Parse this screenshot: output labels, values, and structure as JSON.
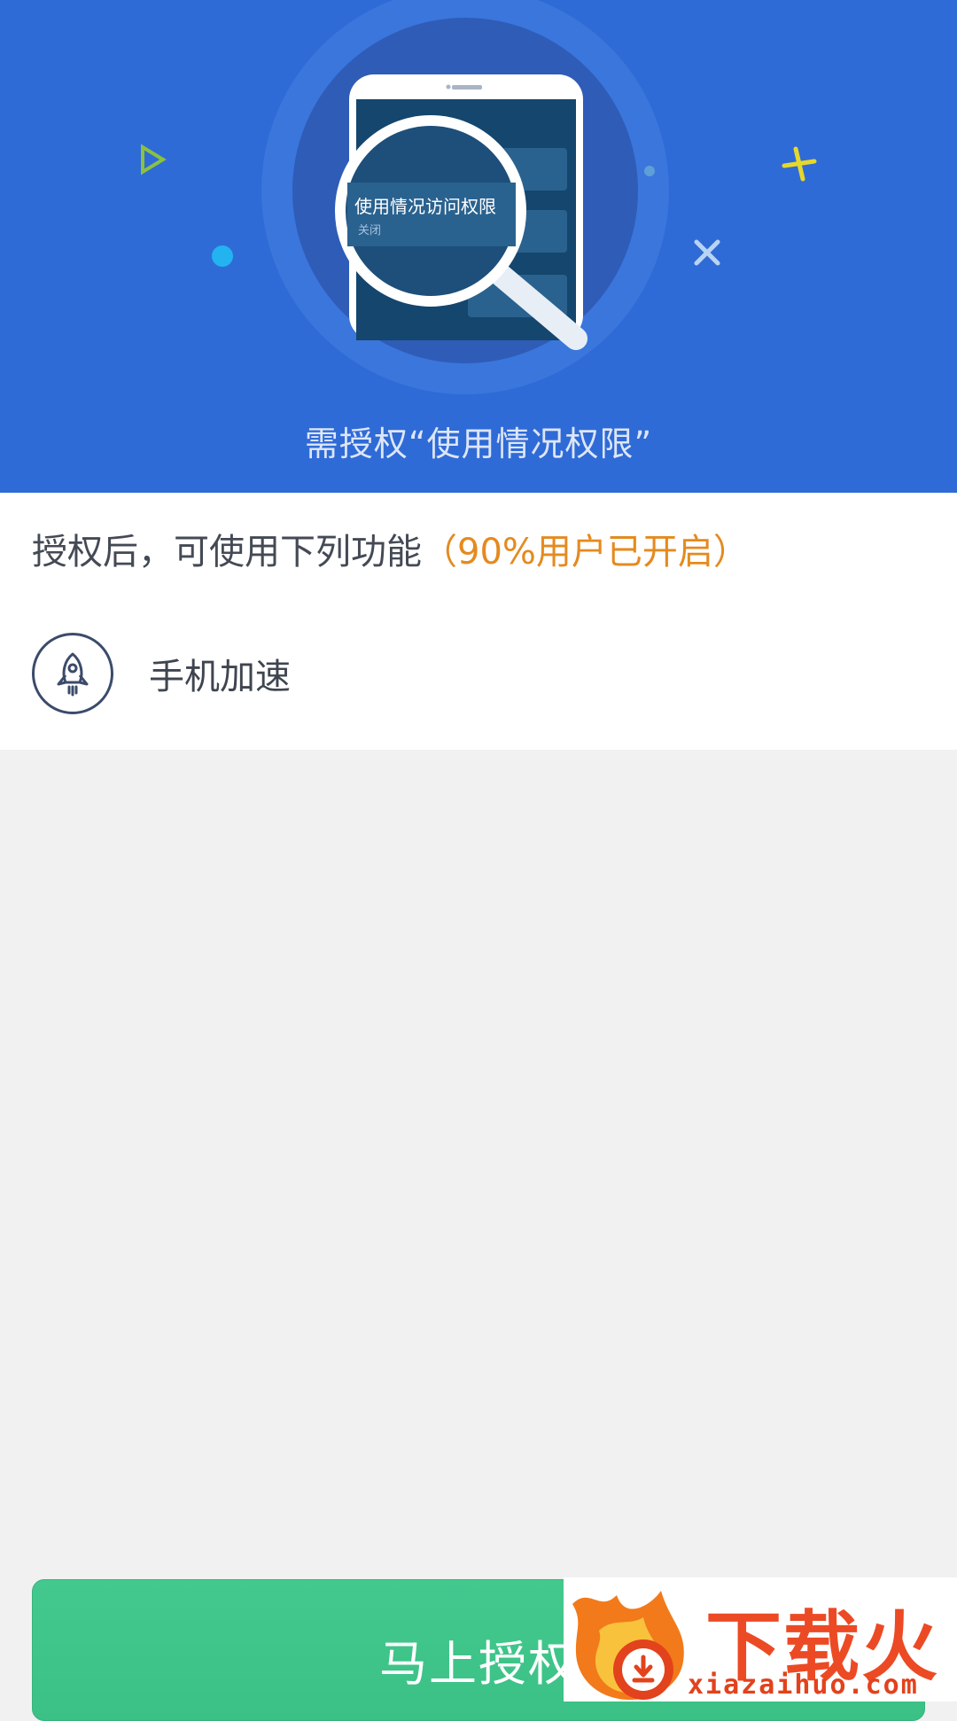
{
  "hero": {
    "illustration_title": "使用情况访问权限",
    "illustration_status": "关闭",
    "caption": "需授权“使用情况权限”"
  },
  "intro": {
    "text": "授权后，可使用下列功能",
    "highlight": "（90%用户已开启）"
  },
  "features": [
    {
      "label": "手机加速",
      "icon": "rocket-icon"
    }
  ],
  "cta": {
    "label": "马上授权"
  },
  "watermark": {
    "brand": "下载火",
    "url": "xiazaihuo.com"
  },
  "colors": {
    "hero_bg": "#2f6bd6",
    "accent_orange": "#e58a1f",
    "button_green": "#43c98e"
  }
}
